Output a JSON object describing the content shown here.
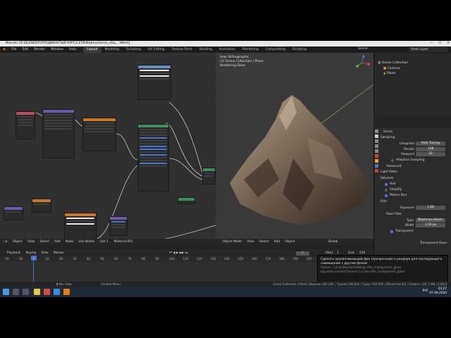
{
  "window": {
    "title": "Blender [D:\\BLENDER\\ПРОДВИНУТЫЙ КУРС\\СЕТИ\\Файлы\\Horse_disp_..\\Mesh]"
  },
  "menu": [
    "File",
    "Edit",
    "Render",
    "Window",
    "Help"
  ],
  "workspaces": [
    "Layout",
    "Modeling",
    "Sculpting",
    "UV Editing",
    "Texture Paint",
    "Shading",
    "Animation",
    "Rendering",
    "Compositing",
    "Scripting"
  ],
  "scene_label": "Scene",
  "view_layer": "View Layer",
  "viewport": {
    "info": [
      "User Orthographic",
      "(1) Scene Collection | Plane",
      "Rendering Done"
    ],
    "header": [
      "Object Mode",
      "View",
      "Select",
      "Add",
      "Object",
      "Global"
    ]
  },
  "node_editor": {
    "material_label": "Material.001",
    "header": [
      "Object",
      "View",
      "Select",
      "Add",
      "Node",
      "Use Nodes",
      "Slot 1",
      "Material.001"
    ]
  },
  "outliner": {
    "title": "Scene Collection",
    "items": [
      "Camera",
      "Plane"
    ]
  },
  "properties": {
    "scene": "Scene",
    "sampling": "Sampling",
    "integrator_label": "Integrator",
    "integrator_value": "Path Tracing",
    "render_label": "Render",
    "render_value": "128",
    "viewport_label": "Viewport",
    "viewport_value": "32",
    "adaptive": "Adaptive Sampling",
    "advanced": "Advanced",
    "light_paths": "Light Paths",
    "volumes": "Volumes",
    "hair": "Hair",
    "simplify": "Simplify",
    "motion_blur": "Motion Blur",
    "film": "Film",
    "exposure_label": "Exposure",
    "exposure_value": "1.00",
    "pixel_filter": "Pixel Filter",
    "type_label": "Type",
    "type_value": "Blackman-Harris",
    "width_label": "Width",
    "width_value": "1.50 px",
    "transparent": "Transparent",
    "transparent_glass": "Transparent Glass",
    "color_management": "Color Management"
  },
  "timeline": {
    "header": [
      "Playback",
      "Keying",
      "View",
      "Marker"
    ],
    "start_label": "Start",
    "start_value": "1",
    "end_label": "End",
    "end_value": "250",
    "current_frame": "1",
    "ticks": [
      "-20",
      "-10",
      "1",
      "10",
      "20",
      "30",
      "40",
      "50",
      "60",
      "70",
      "80",
      "90",
      "100",
      "110",
      "120",
      "130",
      "140",
      "150",
      "160",
      "170",
      "180",
      "190",
      "200",
      "210",
      "220",
      "230",
      "240",
      "250"
    ]
  },
  "tooltip": {
    "lines": [
      "Сделать просвечивающий фон (прозрачным) в рендере для последующего",
      "совмещения с другим фоном"
    ],
    "python": [
      "Python: CyclesRenderSettings.film_transparent_glass",
      "bpy.data.scenes[\"Scene\"].cycles.film_transparent_glass"
    ]
  },
  "status": {
    "left": "Pan View",
    "middle": "Context Menu",
    "right": "Scene Collection | Plane | Вершин:167,281 | Граней:166,931 | Треуг:332,930 | Объектов:0/2 | Память: 221.1 МБ | 2.83.0"
  },
  "taskbar": {
    "lang": "РУС",
    "time": "23:27",
    "date": "07.09.2020"
  }
}
